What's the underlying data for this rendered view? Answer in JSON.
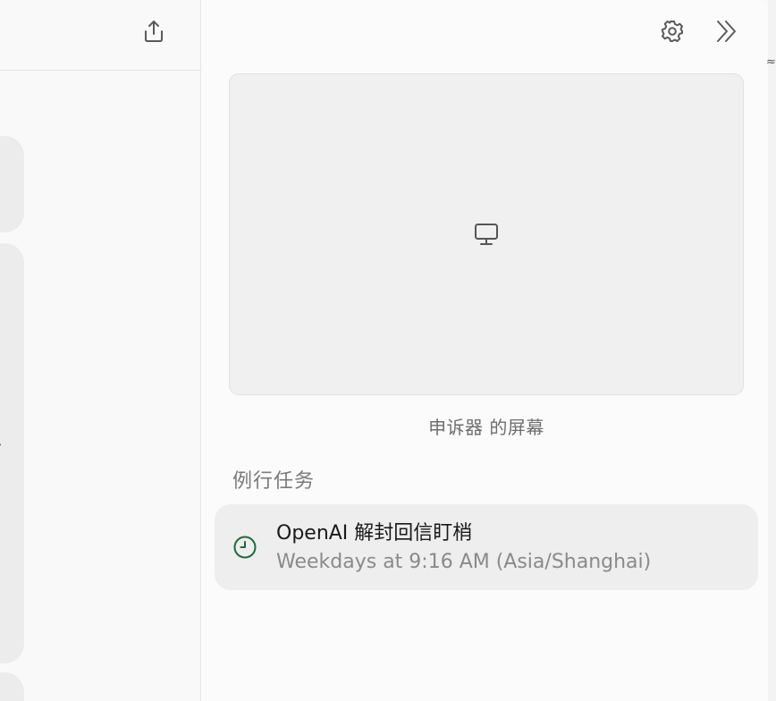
{
  "left_pane": {
    "share_icon": "share-upload-icon"
  },
  "header": {
    "settings_icon": "gear-icon",
    "collapse_icon": "double-chevron-right-icon"
  },
  "screen_preview": {
    "icon": "monitor-icon",
    "caption": "申诉器 的屏幕"
  },
  "routines": {
    "section_title": "例行任务",
    "tasks": [
      {
        "icon": "clock-icon",
        "title": "OpenAI 解封回信盯梢",
        "schedule": "Weekdays at 9:16 AM (Asia/Shanghai)"
      }
    ]
  },
  "colors": {
    "clock_icon": "#1f6b3a",
    "card_background": "#eeeeee",
    "preview_background": "#f0f0f0"
  }
}
